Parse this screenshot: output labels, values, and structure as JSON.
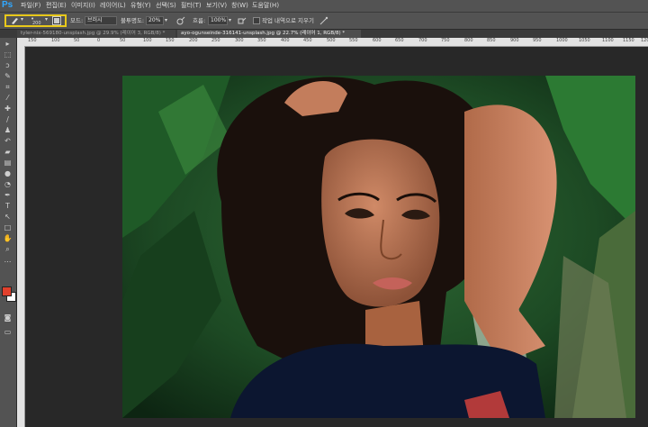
{
  "app": {
    "logo": "Ps"
  },
  "menu": [
    "파일(F)",
    "편집(E)",
    "이미지(I)",
    "레이어(L)",
    "유형(Y)",
    "선택(S)",
    "필터(T)",
    "보기(V)",
    "창(W)",
    "도움말(H)"
  ],
  "options": {
    "brush_size": "200",
    "mode_label": "모드:",
    "mode_value": "브러시",
    "opacity_label": "불투명도:",
    "opacity_value": "20%",
    "flow_label": "흐름:",
    "flow_value": "100%",
    "erase_history_label": "작업 내역으로 지우기"
  },
  "tabs": [
    {
      "label": "tyler-nix-569180-unsplash.jpg @ 29.9% (레이어 3, RGB/8) *",
      "active": false
    },
    {
      "label": "ayo-ogunseinde-316141-unsplash.jpg @ 22.7% (레이어 1, RGB/8) *",
      "active": true
    }
  ],
  "ruler": {
    "ticks": [
      "150",
      "100",
      "50",
      "0",
      "50",
      "100",
      "150",
      "200",
      "250",
      "300",
      "350",
      "400",
      "450",
      "500",
      "550",
      "600",
      "650",
      "700",
      "750",
      "800",
      "850",
      "900",
      "950",
      "1000",
      "1050",
      "1100",
      "1150",
      "1200"
    ]
  },
  "colors": {
    "foreground": "#e0402c",
    "background": "#ffffff",
    "highlight": "#e8c81a"
  },
  "tools": [
    "move-tool",
    "marquee-tool",
    "lasso-tool",
    "quick-select-tool",
    "crop-tool",
    "eyedropper-tool",
    "healing-brush-tool",
    "brush-tool",
    "clone-stamp-tool",
    "history-brush-tool",
    "eraser-tool",
    "gradient-tool",
    "blur-tool",
    "dodge-tool",
    "pen-tool",
    "type-tool",
    "path-select-tool",
    "rectangle-tool",
    "hand-tool",
    "zoom-tool"
  ]
}
